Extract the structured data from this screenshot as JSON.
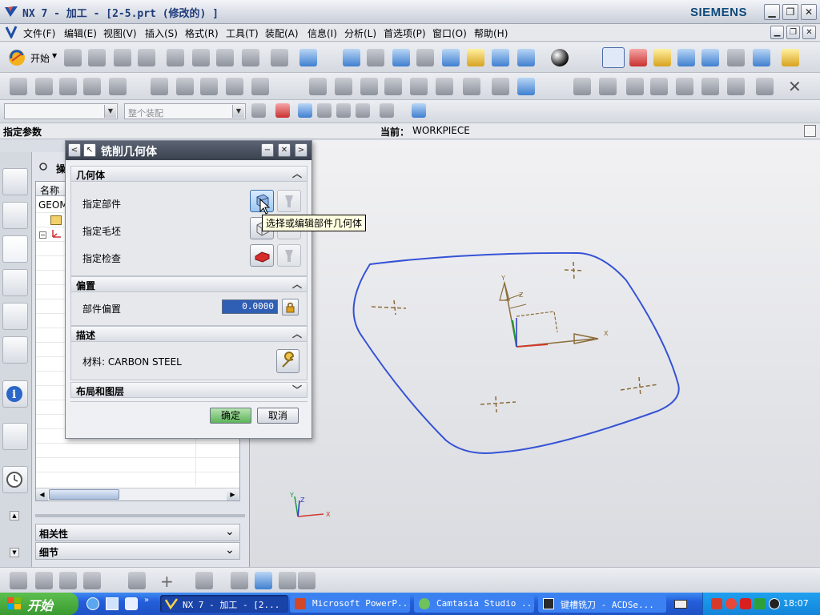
{
  "window": {
    "title": "NX 7 - 加工 - [2-5.prt (修改的) ]",
    "brand": "SIEMENS",
    "icons": [
      "nx-logo-icon",
      "minimize-icon",
      "restore-icon",
      "close-icon"
    ]
  },
  "menubar": {
    "items": [
      "文件(F)",
      "编辑(E)",
      "视图(V)",
      "插入(S)",
      "格式(R)",
      "工具(T)",
      "装配(A)",
      "信息(I)",
      "分析(L)",
      "首选项(P)",
      "窗口(O)",
      "帮助(H)"
    ]
  },
  "toolbar": {
    "start_label": "开始"
  },
  "selection_bar": {
    "filter_value": "",
    "scope_value": "整个装配"
  },
  "cue_line": {
    "prompt": "指定参数",
    "status_label": "当前：",
    "status_value": "WORKPIECE"
  },
  "navigator": {
    "title": "操",
    "column_name": "名称",
    "first_row": "GEOM",
    "sections": [
      "相关性",
      "细节"
    ]
  },
  "dialog": {
    "title": "铣削几何体",
    "groups": {
      "geometry": {
        "title": "几何体",
        "rows": [
          "指定部件",
          "指定毛坯",
          "指定检查"
        ]
      },
      "offset": {
        "title": "偏置",
        "label": "部件偏置",
        "value": "0.0000"
      },
      "description": {
        "title": "描述",
        "material_text": "材料: CARBON STEEL"
      },
      "layout": {
        "title": "布局和图层"
      }
    },
    "ok_label": "确定",
    "cancel_label": "取消"
  },
  "tooltip": {
    "text": "选择或编辑部件几何体"
  },
  "graphics": {
    "wcs_labels": [
      "X",
      "Y",
      "Z"
    ],
    "outline_color": "#3552d6"
  },
  "taskbar": {
    "start_label": "开始",
    "tasks": [
      "NX 7 - 加工 - [2...",
      "Microsoft PowerP...",
      "Camtasia Studio ...",
      "键槽铣刀 - ACDSe..."
    ],
    "clock": "18:07"
  }
}
